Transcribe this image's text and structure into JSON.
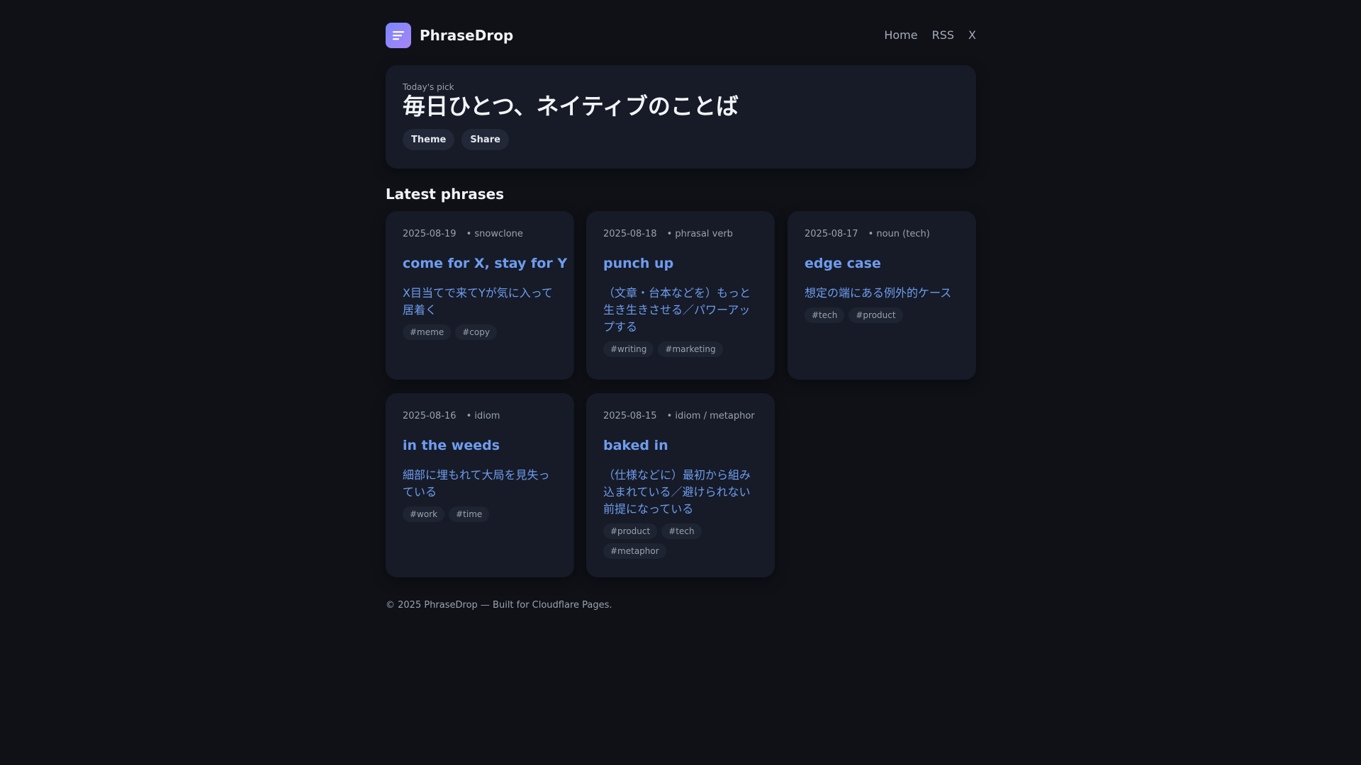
{
  "header": {
    "brand": "PhraseDrop",
    "logo_icon": "menu-lines-icon",
    "nav": [
      {
        "label": "Home"
      },
      {
        "label": "RSS"
      },
      {
        "label": "X"
      }
    ]
  },
  "hero": {
    "label": "Today's pick",
    "title": "毎日ひとつ、ネイティブのことば",
    "buttons": [
      {
        "label": "Theme"
      },
      {
        "label": "Share"
      }
    ]
  },
  "section_title": "Latest phrases",
  "cards": [
    {
      "date": "2025-08-19",
      "type": "• snowclone",
      "title": "come for X, stay for Y",
      "desc": "X目当てで来てYが気に入って居着く",
      "tags": [
        "#meme",
        "#copy"
      ]
    },
    {
      "date": "2025-08-18",
      "type": "• phrasal verb",
      "title": "punch up",
      "desc": "（文章・台本などを）もっと生き生きさせる／パワーアップする",
      "tags": [
        "#writing",
        "#marketing"
      ]
    },
    {
      "date": "2025-08-17",
      "type": "• noun (tech)",
      "title": "edge case",
      "desc": "想定の端にある例外的ケース",
      "tags": [
        "#tech",
        "#product"
      ]
    },
    {
      "date": "2025-08-16",
      "type": "• idiom",
      "title": "in the weeds",
      "desc": "細部に埋もれて大局を見失っている",
      "tags": [
        "#work",
        "#time"
      ]
    },
    {
      "date": "2025-08-15",
      "type": "• idiom / metaphor",
      "title": "baked in",
      "desc": "（仕様などに）最初から組み込まれている／避けられない前提になっている",
      "tags": [
        "#product",
        "#tech",
        "#metaphor"
      ]
    }
  ],
  "footer": "© 2025 PhraseDrop — Built for Cloudflare Pages.",
  "colors": {
    "background": "#0f1117",
    "card": "#161b27",
    "accent": "#6f9cf0",
    "logo_gradient_start": "#7b86ff",
    "logo_gradient_end": "#a786f5"
  }
}
